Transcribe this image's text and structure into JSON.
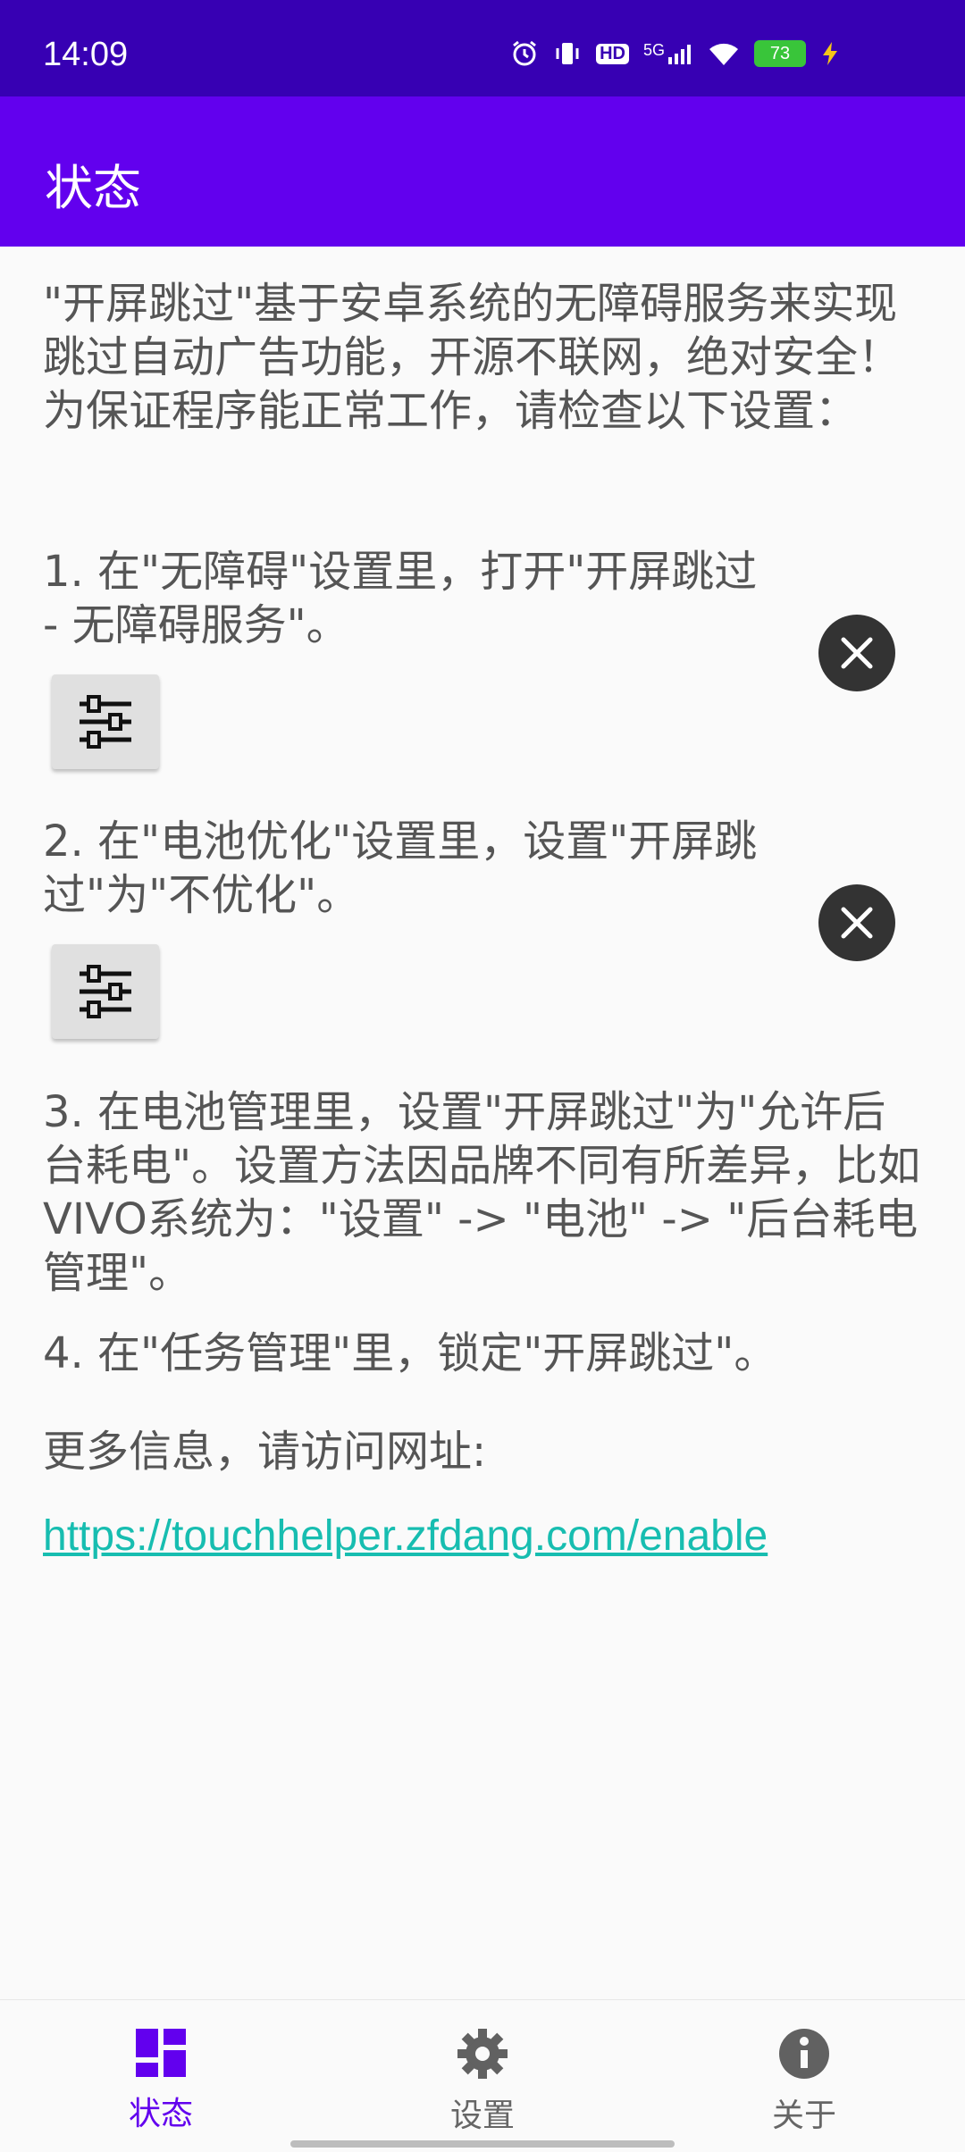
{
  "status_bar": {
    "time": "14:09",
    "icons": [
      "alarm-icon",
      "vibrate-icon",
      "hd-icon",
      "signal-5g-icon",
      "wifi-icon",
      "battery-icon",
      "charging-icon"
    ],
    "hd_label": "HD",
    "net_label": "5G",
    "battery_level": "73"
  },
  "app_bar": {
    "title": "状态"
  },
  "content": {
    "intro": "\"开屏跳过\"基于安卓系统的无障碍服务来实现跳过自动广告功能，开源不联网，绝对安全！为保证程序能正常工作，请检查以下设置：",
    "step1": "1. 在\"无障碍\"设置里，打开\"开屏跳过 - 无障碍服务\"。",
    "step2": "2. 在\"电池优化\"设置里，设置\"开屏跳过\"为\"不优化\"。",
    "step3": "3. 在电池管理里，设置\"开屏跳过\"为\"允许后台耗电\"。设置方法因品牌不同有所差异，比如VIVO系统为：\"设置\" -> \"电池\" -> \"后台耗电管理\"。",
    "step4": "4. 在\"任务管理\"里，锁定\"开屏跳过\"。",
    "more_info": "更多信息，请访问网址:",
    "link": "https://touchhelper.zfdang.com/enable"
  },
  "bottom_nav": {
    "items": [
      {
        "label": "状态",
        "icon": "dashboard-icon",
        "active": true
      },
      {
        "label": "设置",
        "icon": "gear-icon",
        "active": false
      },
      {
        "label": "关于",
        "icon": "info-icon",
        "active": false
      }
    ]
  },
  "colors": {
    "status_bar": "#3700b3",
    "app_bar": "#6200ee",
    "active_nav": "#6200ee",
    "link": "#17bdb0"
  }
}
